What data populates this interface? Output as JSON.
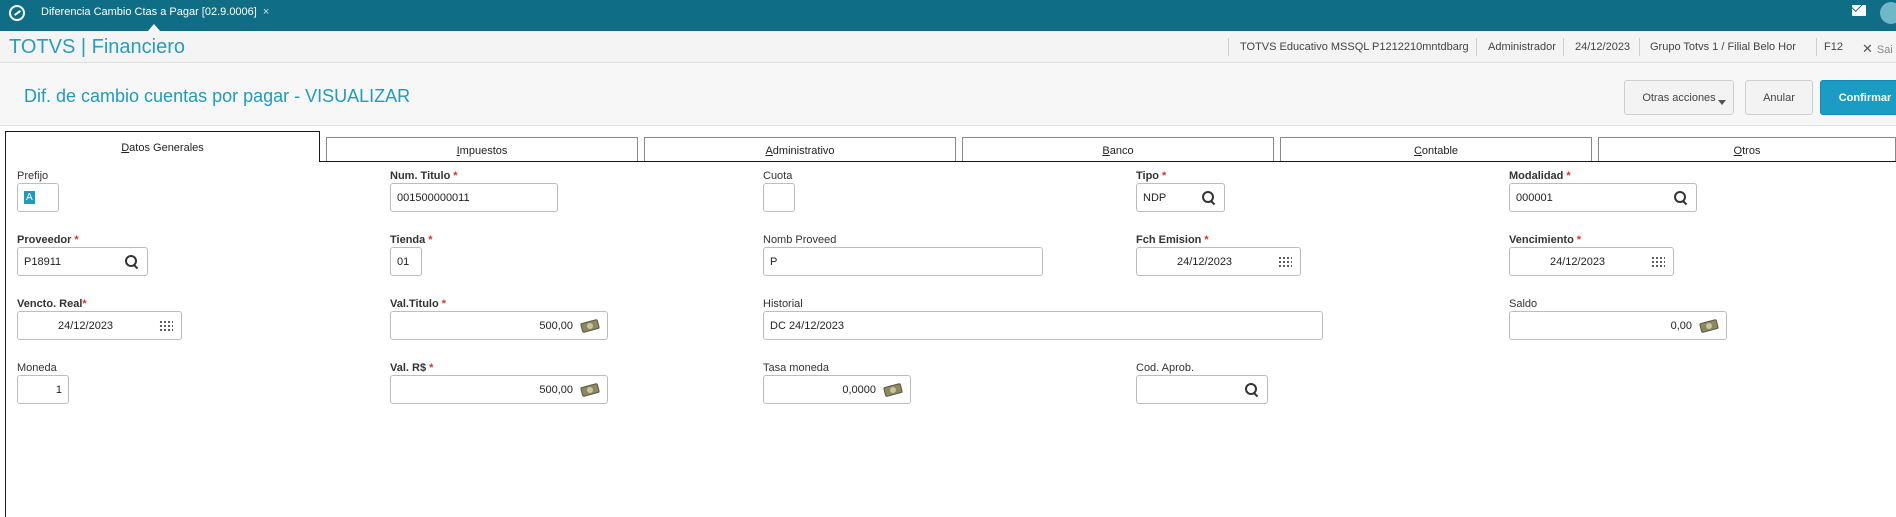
{
  "topbar": {
    "tab_label": "Diferencia Cambio Ctas a Pagar [02.9.0006]",
    "tab_close": "×"
  },
  "header": {
    "brand": "TOTVS | Financiero",
    "environment": "TOTVS Educativo MSSQL P1212210mntdbarg",
    "user": "Administrador",
    "date": "24/12/2023",
    "branch": "Grupo Totvs 1 / Filial Belo Hor",
    "shortcut": "F12",
    "exit_label": "Sai"
  },
  "page": {
    "title": "Dif. de cambio cuentas por pagar - VISUALIZAR",
    "otras_label": "Otras acciones",
    "anular_label": "Anular",
    "confirmar_label": "Confirmar"
  },
  "tabs": [
    {
      "first": "D",
      "rest": "atos Generales"
    },
    {
      "first": "I",
      "rest": "mpuestos"
    },
    {
      "first": "A",
      "rest": "dministrativo"
    },
    {
      "first": "B",
      "rest": "anco"
    },
    {
      "first": "C",
      "rest": "ontable"
    },
    {
      "first": "O",
      "rest": "tros"
    }
  ],
  "form": {
    "prefijo": {
      "label": "Prefijo",
      "value": "A"
    },
    "num_titulo": {
      "label": "Num. Titulo",
      "value": "001500000011"
    },
    "cuota": {
      "label": "Cuota",
      "value": ""
    },
    "tipo": {
      "label": "Tipo",
      "value": "NDP"
    },
    "modalidad": {
      "label": "Modalidad",
      "value": "000001"
    },
    "proveedor": {
      "label": "Proveedor",
      "value": "P18911"
    },
    "tienda": {
      "label": "Tienda",
      "value": "01"
    },
    "nomb_proveed": {
      "label": "Nomb Proveed",
      "value": "P"
    },
    "fch_emision": {
      "label": "Fch Emision",
      "value": "24/12/2023"
    },
    "vencimiento": {
      "label": "Vencimiento",
      "value": "24/12/2023"
    },
    "vencto_real": {
      "label": "Vencto. Real",
      "value": "24/12/2023"
    },
    "val_titulo": {
      "label": "Val.Titulo",
      "value": "500,00"
    },
    "historial": {
      "label": "Historial",
      "value": "DC 24/12/2023"
    },
    "saldo": {
      "label": "Saldo",
      "value": "0,00"
    },
    "moneda": {
      "label": "Moneda",
      "value": "1"
    },
    "val_rs": {
      "label": "Val. R$",
      "value": "500,00"
    },
    "tasa_moneda": {
      "label": "Tasa moneda",
      "value": "0,0000"
    },
    "cod_aprob": {
      "label": "Cod. Aprob.",
      "value": ""
    }
  },
  "icons": {
    "search": "search-icon",
    "calendar": "calendar-icon",
    "money": "money-icon"
  }
}
